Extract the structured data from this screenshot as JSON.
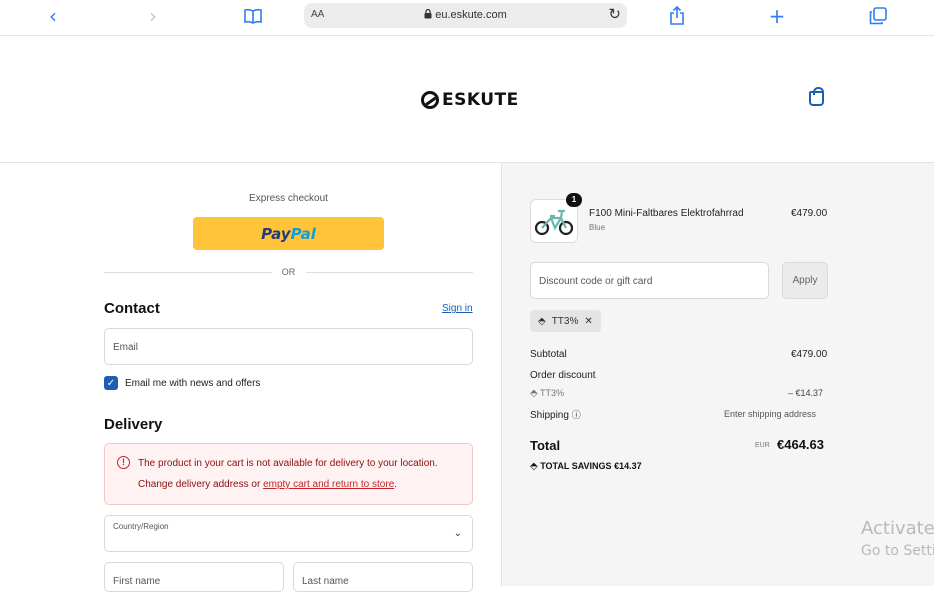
{
  "browser": {
    "text_size": "AA",
    "url": "eu.eskute.com"
  },
  "header": {
    "brand": "ESKUTE"
  },
  "checkout": {
    "express_label": "Express checkout",
    "paypal_pay": "Pay",
    "paypal_pal": "Pal",
    "or_label": "OR",
    "contact_title": "Contact",
    "sign_in": "Sign in",
    "email_placeholder": "Email",
    "newsletter_label": "Email me with news and offers",
    "newsletter_checked": true,
    "delivery_title": "Delivery",
    "error_line1": "The product in your cart is not available for delivery to your location.",
    "error_line2_prefix": "Change delivery address or",
    "error_link": "empty cart and return to store",
    "error_line2_suffix": ".",
    "country_label": "Country/Region",
    "first_name_label": "First name",
    "last_name_label": "Last name"
  },
  "summary": {
    "item": {
      "quantity": "1",
      "name": "F100 Mini-Faltbares Elektrofahrrad",
      "variant": "Blue",
      "price": "€479.00"
    },
    "discount_placeholder": "Discount code or gift card",
    "apply_label": "Apply",
    "applied_code": "TT3%",
    "subtotal_label": "Subtotal",
    "subtotal_value": "€479.00",
    "order_discount_label": "Order discount",
    "discount_code": "TT3%",
    "discount_value": "– €14.37",
    "shipping_label": "Shipping",
    "shipping_value": "Enter shipping address",
    "total_label": "Total",
    "currency": "EUR",
    "total_value": "€464.63",
    "savings_label": "TOTAL SAVINGS",
    "savings_value": "€14.37"
  },
  "overlay": {
    "activate_line1": "Activate",
    "activate_line2": "Go to Setti"
  },
  "icons": {
    "back": "chevron-left-icon",
    "forward": "chevron-right-icon",
    "bookmarks": "book-icon",
    "lock": "lock-icon",
    "reload": "reload-icon",
    "share": "share-icon",
    "add": "plus-icon",
    "tabs": "tabs-icon",
    "cart": "bag-icon",
    "error": "alert-circle-icon",
    "tag": "tag-icon",
    "close": "close-icon",
    "help": "help-circle-icon",
    "dropdown": "chevron-down-icon"
  },
  "colors": {
    "link": "#1a5fb4",
    "paypal_yellow": "#ffc439",
    "error_red": "#c5242b",
    "summary_bg": "#f5f5f5"
  }
}
